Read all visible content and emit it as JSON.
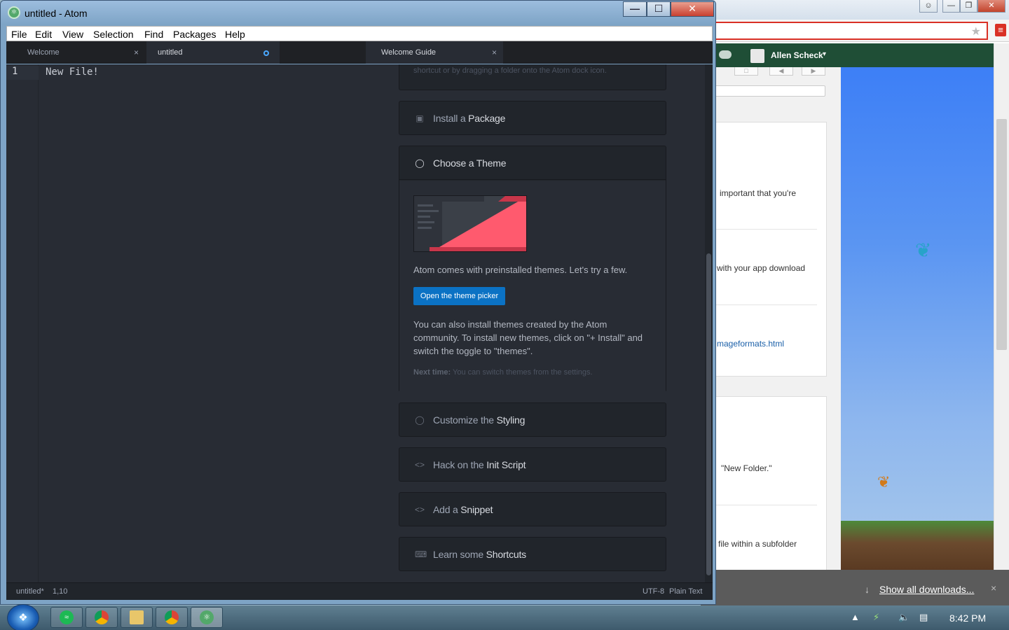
{
  "atom": {
    "title": "untitled - Atom",
    "menu": [
      "File",
      "Edit",
      "View",
      "Selection",
      "Find",
      "Packages",
      "Help"
    ],
    "left_tabs": [
      {
        "label": "Welcome",
        "close": "×"
      },
      {
        "label": "untitled"
      }
    ],
    "right_tabs": [
      {
        "label": "Welcome Guide",
        "close": "×"
      }
    ],
    "editor": {
      "line_number": "1",
      "content": "New File!"
    },
    "guide": {
      "cut_card_text": "shortcut or by dragging a folder onto the Atom dock icon.",
      "cards": {
        "package": {
          "prefix": "Install a ",
          "bold": "Package",
          "icon": "package-icon"
        },
        "theme": {
          "prefix": "Choose a ",
          "bold": "Theme",
          "icon": "paintcan-icon"
        },
        "styling": {
          "prefix": "Customize the ",
          "bold": "Styling",
          "icon": "paintcan-icon"
        },
        "init": {
          "prefix": "Hack on the ",
          "bold": "Init Script",
          "icon": "code-icon"
        },
        "snippet": {
          "prefix": "Add a ",
          "bold": "Snippet",
          "icon": "code-icon"
        },
        "shortcuts": {
          "prefix": "Learn some ",
          "bold": "Shortcuts",
          "icon": "keyboard-icon"
        }
      },
      "theme_body": {
        "description": "Atom comes with preinstalled themes. Let's try a few.",
        "button_label": "Open the theme picker",
        "community_text": "You can also install themes created by the Atom community. To install new themes, click on \"+ Install\" and switch the toggle to \"themes\".",
        "next_time_label": "Next time:",
        "next_time_text": " You can switch themes from the settings."
      }
    },
    "status": {
      "file": "untitled*",
      "cursor": "1,10",
      "encoding": "UTF-8",
      "grammar": "Plain Text"
    }
  },
  "chrome": {
    "user_name": "Allen Scheck",
    "user_caret": "▾",
    "content_lines": [
      "important that you're",
      "with your app download",
      "mageformats.html",
      "\"New Folder.\"",
      "file within a subfolder"
    ],
    "downloads_label": "Show all downloads...",
    "downloads_close": "×"
  },
  "taskbar": {
    "clock": "8:42 PM"
  },
  "colors": {
    "accent_blue": "#0b72c4",
    "theme_preview_red": "#ff5a6e",
    "chrome_green": "#1f4e36",
    "chrome_red": "#d93025"
  }
}
